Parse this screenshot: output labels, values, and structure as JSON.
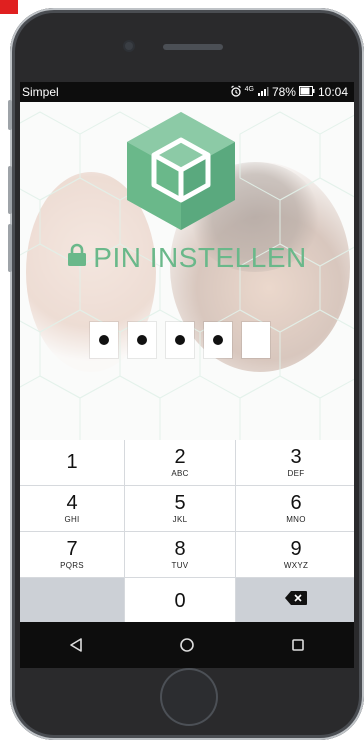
{
  "status_bar": {
    "carrier": "Simpel",
    "network": "4G",
    "battery": "78%",
    "time": "10:04"
  },
  "header": {
    "title": "PIN INSTELLEN"
  },
  "pin": {
    "length": 5,
    "filled": 4
  },
  "keypad": {
    "keys": [
      {
        "digit": "1",
        "letters": ""
      },
      {
        "digit": "2",
        "letters": "ABC"
      },
      {
        "digit": "3",
        "letters": "DEF"
      },
      {
        "digit": "4",
        "letters": "GHI"
      },
      {
        "digit": "5",
        "letters": "JKL"
      },
      {
        "digit": "6",
        "letters": "MNO"
      },
      {
        "digit": "7",
        "letters": "PQRS"
      },
      {
        "digit": "8",
        "letters": "TUV"
      },
      {
        "digit": "9",
        "letters": "WXYZ"
      },
      {
        "digit": "0",
        "letters": ""
      }
    ]
  },
  "colors": {
    "accent": "#6ab88a",
    "logo_dark": "#5aa97e",
    "logo_light": "#a8d7bb"
  }
}
